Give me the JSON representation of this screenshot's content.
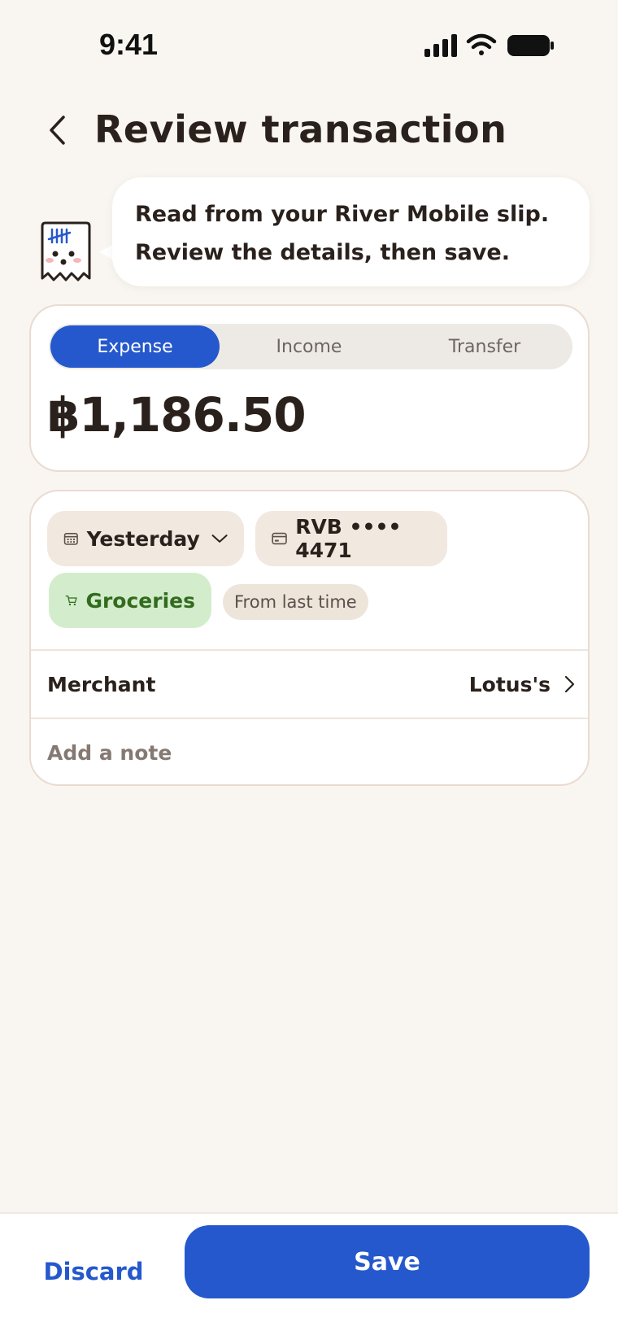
{
  "status_bar": {
    "time": "9:41",
    "icons": [
      "signal-icon",
      "wifi-icon",
      "battery-icon"
    ]
  },
  "header": {
    "title": "Review transaction",
    "back_icon": "chevron-left-icon"
  },
  "assistant": {
    "line1": "Read from your River Mobile slip.",
    "line2": "Review the details, then save."
  },
  "type_selector": {
    "options": [
      "Expense",
      "Income",
      "Transfer"
    ],
    "selected": "Expense"
  },
  "amount": "฿1,186.50",
  "details": {
    "date_chip": "Yesterday",
    "account_chip": "RVB •••• 4471",
    "category_chip": "Groceries",
    "category_hint": "From last time",
    "merchant_label": "Merchant",
    "merchant_value": "Lotus's",
    "note_placeholder": "Add a note"
  },
  "actions": {
    "discard": "Discard",
    "save": "Save"
  },
  "colors": {
    "accent": "#2558CC",
    "background": "#F9F6F1",
    "category_bg": "#D3EDCC",
    "category_fg": "#336B1E"
  }
}
